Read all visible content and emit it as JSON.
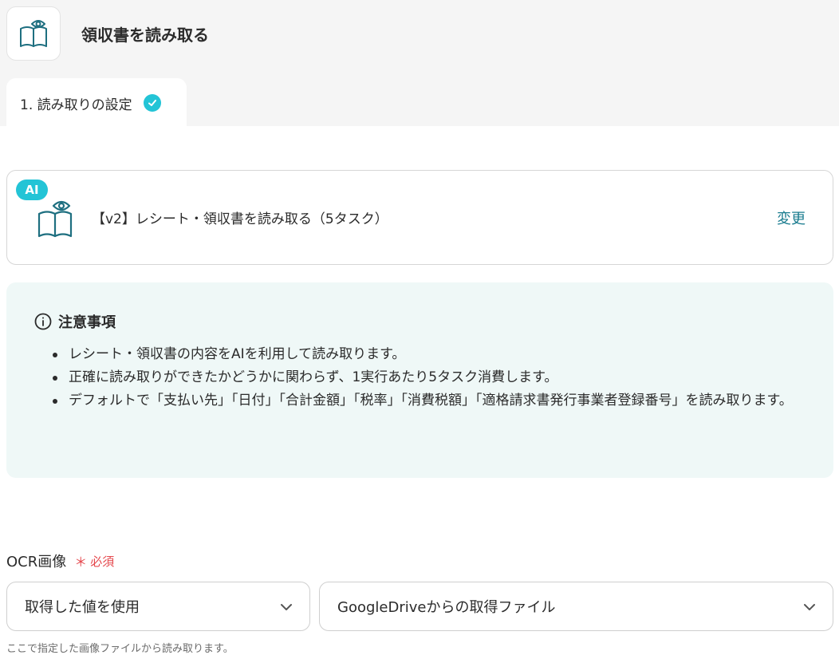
{
  "header": {
    "title": "領収書を読み取る",
    "icon": "book-eye-icon"
  },
  "steps": [
    {
      "label": "1. 読み取りの設定",
      "status": "completed"
    }
  ],
  "action": {
    "badge": "AI",
    "name": "【v2】レシート・領収書を読み取る（5タスク）",
    "change_label": "変更",
    "icon": "book-eye-icon"
  },
  "notice": {
    "title": "注意事項",
    "icon": "info-icon",
    "items": [
      "レシート・領収書の内容をAIを利用して読み取ります。",
      "正確に読み取りができたかどうかに関わらず、1実行あたり5タスク消費します。",
      "デフォルトで「支払い先」「日付」「合計金額」「税率」「消費税額」「適格請求書発行事業者登録番号」を読み取ります。"
    ]
  },
  "field": {
    "label": "OCR画像",
    "required_star": "＊",
    "required_text": "必須",
    "source_select": "取得した値を使用",
    "value_select": "GoogleDriveからの取得ファイル",
    "helper": "ここで指定した画像ファイルから読み取ります。"
  },
  "colors": {
    "accent": "#23c4d6",
    "link": "#1a7c8f",
    "required": "#e5484d",
    "notice_bg": "#eff8f7"
  }
}
